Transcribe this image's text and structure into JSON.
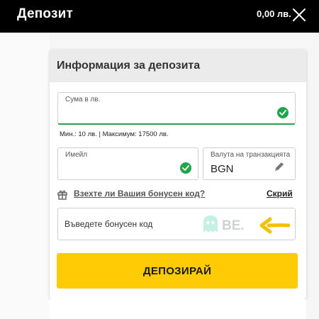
{
  "header": {
    "title": "Депозит",
    "balance": "0,00 лв.",
    "close_icon": "close-icon"
  },
  "card": {
    "title": "Информация за депозита"
  },
  "amount_field": {
    "label": "Сума в лв.",
    "value": "",
    "valid": true
  },
  "limits": {
    "text": "Мин.: 10 лв.  | Максимум: 17500 лв."
  },
  "email_field": {
    "label": "Имейл",
    "value": "",
    "valid": true
  },
  "currency_field": {
    "label": "Валута на транзакцията",
    "value": "BGN",
    "icon": "pencil-icon"
  },
  "bonus": {
    "question": "Взехте ли Вашия бонусен код?",
    "hide_label": "Скрий",
    "placeholder": "Въведете бонусен код",
    "gift_icon": "gift-icon"
  },
  "watermark": {
    "text": "BE."
  },
  "deposit_button": {
    "label": "ДЕПОЗИРАЙ"
  },
  "colors": {
    "accent": "#ffcb05",
    "success": "#1fa64a",
    "header_bg": "#000000"
  }
}
